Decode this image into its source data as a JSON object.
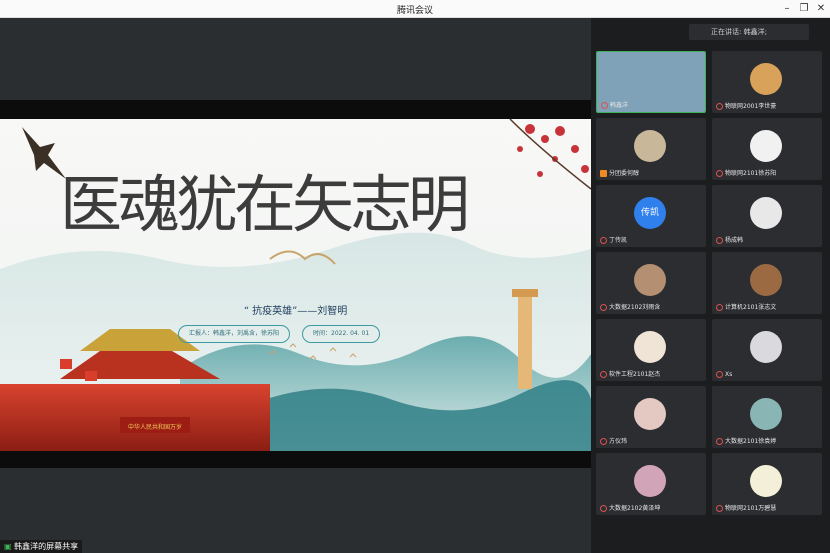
{
  "window": {
    "title": "腾讯会议"
  },
  "slide": {
    "title": "医魂犹在矢志明",
    "subtitle": "“ 抗疫英雄”——刘智明",
    "presenters": "汇报人：韩鑫洋，刘禹含，徐苏阳",
    "date": "时间：2022. 04. 01"
  },
  "status": {
    "share_label": "韩鑫洋的屏幕共享"
  },
  "panel": {
    "speaking": "正在讲话: 韩鑫洋;",
    "participants": [
      {
        "name": "韩鑫洋",
        "active": true,
        "avatar_color": "#7fa2b8"
      },
      {
        "name": "物联网2001李世豪",
        "avatar_color": "#d8a25a"
      },
      {
        "name": "分团委何醇",
        "avatar_color": "#c9b79a",
        "badge": true
      },
      {
        "name": "物联网2101徐苏阳",
        "avatar_color": "#f1f1f1"
      },
      {
        "name": "丁传凯",
        "avatar_color": "#2f80ed",
        "avatar_text": "传凯"
      },
      {
        "name": "杨成韩",
        "avatar_color": "#e8e8e8"
      },
      {
        "name": "大数据2102刘雨含",
        "avatar_color": "#b58f72"
      },
      {
        "name": "计算机2101张志文",
        "avatar_color": "#9b6a43"
      },
      {
        "name": "软件工程2101赵杰",
        "avatar_color": "#efe4d5"
      },
      {
        "name": "Xs",
        "avatar_color": "#d9d9de"
      },
      {
        "name": "方仪玮",
        "avatar_color": "#e3c9c2"
      },
      {
        "name": "大数据2101徐袁婷",
        "avatar_color": "#8ab5b5"
      },
      {
        "name": "大数据2102黄泽坤",
        "avatar_color": "#d2a4b8"
      },
      {
        "name": "物联网2101万碧慧",
        "avatar_color": "#f4efd8"
      }
    ]
  }
}
